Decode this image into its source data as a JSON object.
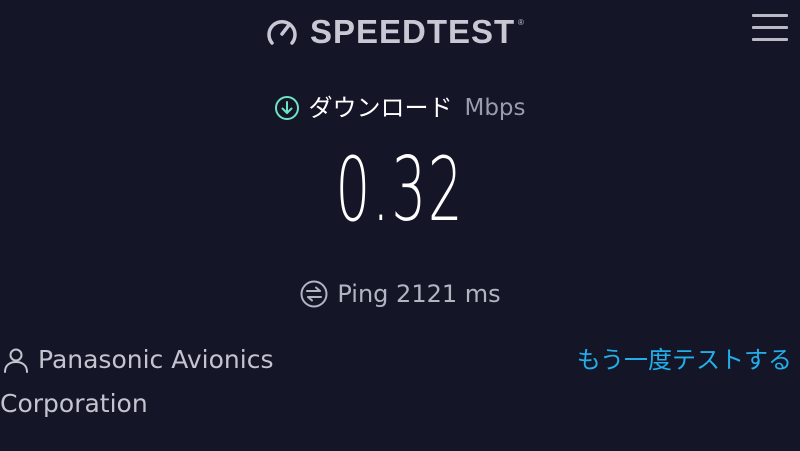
{
  "header": {
    "brand_name": "SPEEDTEST",
    "brand_mark": "®",
    "logo_icon": "gauge-icon",
    "menu_icon": "hamburger-menu-icon"
  },
  "download": {
    "icon": "download-arrow-icon",
    "label": "ダウンロード",
    "unit": "Mbps",
    "value": "0.32"
  },
  "ping": {
    "icon": "ping-icon",
    "text": "Ping 2121 ms"
  },
  "provider": {
    "icon": "user-icon",
    "name_line1": "Panasonic Avionics",
    "name_line2": "Corporation"
  },
  "actions": {
    "retest_label": "もう一度テストする"
  },
  "colors": {
    "background": "#141526",
    "accent_download": "#6fe3c6",
    "link": "#22aeea",
    "muted_text": "#9a9bab"
  }
}
